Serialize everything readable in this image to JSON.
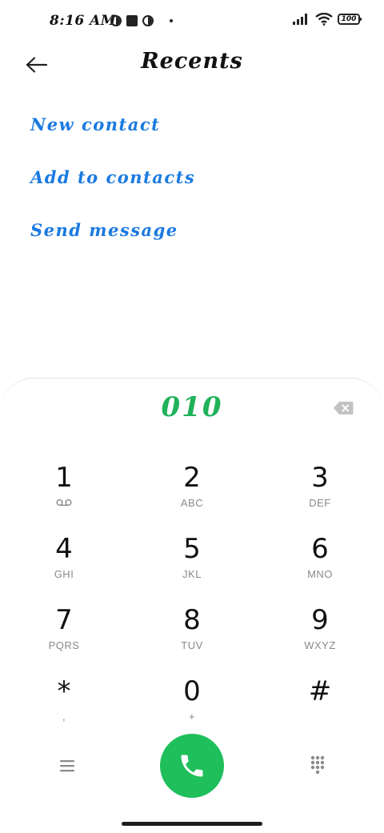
{
  "status_bar": {
    "time": "8:16 AM",
    "battery": "100"
  },
  "header": {
    "title": "Recents",
    "back_icon": "arrow-left-icon"
  },
  "actions": [
    {
      "label": "New contact"
    },
    {
      "label": "Add to contacts"
    },
    {
      "label": "Send message"
    }
  ],
  "dialer": {
    "number": "010",
    "keys": [
      {
        "digit": "1",
        "letters": ""
      },
      {
        "digit": "2",
        "letters": "ABC"
      },
      {
        "digit": "3",
        "letters": "DEF"
      },
      {
        "digit": "4",
        "letters": "GHI"
      },
      {
        "digit": "5",
        "letters": "JKL"
      },
      {
        "digit": "6",
        "letters": "MNO"
      },
      {
        "digit": "7",
        "letters": "PQRS"
      },
      {
        "digit": "8",
        "letters": "TUV"
      },
      {
        "digit": "9",
        "letters": "WXYZ"
      },
      {
        "digit": "*",
        "letters": ","
      },
      {
        "digit": "0",
        "letters": "+"
      },
      {
        "digit": "#",
        "letters": ""
      }
    ]
  },
  "colors": {
    "accent_blue": "#1a7ae0",
    "dialed_green": "#20b25a",
    "call_green": "#1fbf5c"
  }
}
